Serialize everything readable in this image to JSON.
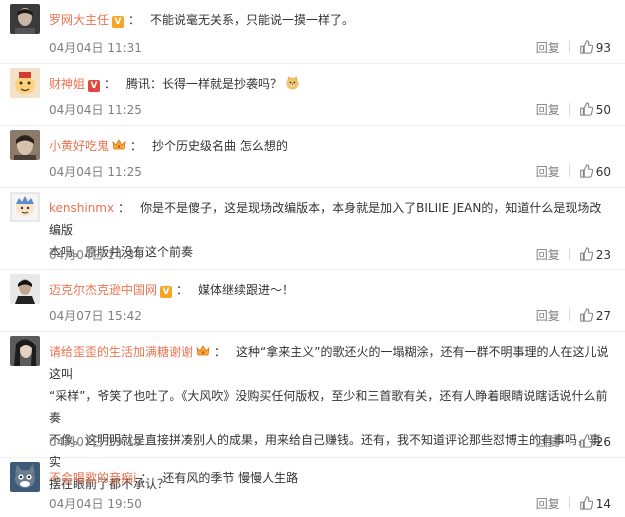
{
  "comments": [
    {
      "user": "罗网大主任",
      "badge": "V",
      "content": "不能说毫无关系，只能说一摸一样了。",
      "time": "04月04日 11:31",
      "reply_label": "回复",
      "likes": "93"
    },
    {
      "user": "财神姐",
      "badge": "V",
      "content": "腾讯：长得一样就是抄袭吗？",
      "emoji": "doge-emoji",
      "time": "04月04日 11:25",
      "reply_label": "回复",
      "likes": "50"
    },
    {
      "user": "小黄好吃鬼",
      "content": "抄个历史级名曲 怎么想的",
      "time": "04月04日 11:25",
      "reply_label": "回复",
      "likes": "60"
    },
    {
      "user": "kenshinmx",
      "content_line1": "你是不是傻子，这是现场改编版本，本身就是加入了BILIIE JEAN的，知道什么是现场改编版",
      "content_line2": "本吗。原版并没有这个前奏",
      "time": "04月04日 14:34",
      "reply_label": "回复",
      "likes": "23"
    },
    {
      "user": "迈克尔杰克逊中国网",
      "badge": "V",
      "content": "媒体继续跟进～！",
      "time": "04月07日 15:42",
      "reply_label": "回复",
      "likes": "27"
    },
    {
      "user": "请给歪歪的生活加满糖谢谢",
      "content_line1": "这种“拿来主义”的歌还火的一塌糊涂，还有一群不明事理的人在这儿说这叫",
      "content_line2": "“采样”，爷笑了也吐了。《大风吹》没购买任何版权，至少和三首歌有关，还有人睁着眼睛说瞎话说什么前奏",
      "content_line3": "不像。这明明就是直接拼凑别人的成果，用来给自己赚钱。还有，我不知道评论那些怼博主的有事吗，事实",
      "content_line4": "摆在眼前了都不承认？",
      "time": "04月07日 19:19",
      "reply_label": "回复",
      "likes": "26"
    },
    {
      "user": "不会唱歌的音痴i",
      "content": "还有风的季节 慢慢人生路",
      "time": "04月04日 19:50",
      "reply_label": "回复",
      "likes": "14"
    }
  ]
}
